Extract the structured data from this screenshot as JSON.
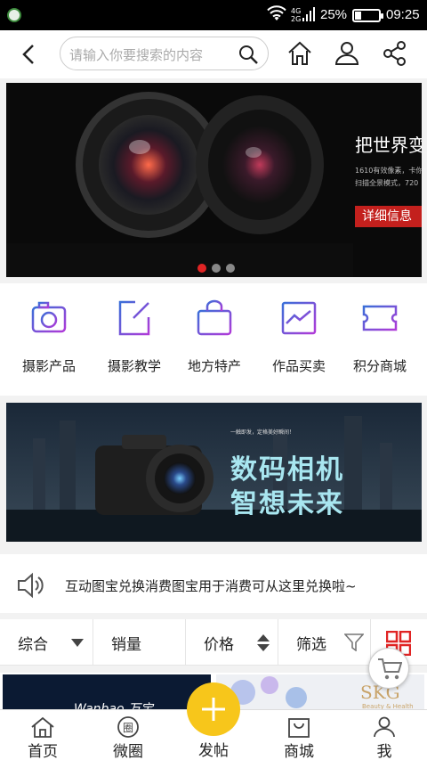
{
  "status_bar": {
    "network": "4G 2G",
    "battery_percent": "25%",
    "battery_level": 0.25,
    "time": "09:25"
  },
  "header": {
    "search_placeholder": "请输入你要搜索的内容"
  },
  "banner": {
    "headline": "把世界变",
    "detail_lines": "1610有效像素，卡你\n扫描全景模式，720",
    "button": "详细信息",
    "slide_count": 3,
    "active_slide": 1
  },
  "categories": [
    {
      "label": "摄影产品",
      "icon": "camera-icon"
    },
    {
      "label": "摄影教学",
      "icon": "edit-icon"
    },
    {
      "label": "地方特产",
      "icon": "shopping-bag-icon"
    },
    {
      "label": "作品买卖",
      "icon": "image-icon"
    },
    {
      "label": "积分商城",
      "icon": "ticket-icon"
    }
  ],
  "banner2": {
    "tagline": "一触即发，定格美好瞬间！",
    "line1": "数码相机",
    "line2": "智想未来"
  },
  "notice": {
    "text": "互动图宝兑换消费图宝用于消费可从这里兑换啦~"
  },
  "filters": {
    "sort_all": "综合",
    "sales": "销量",
    "price": "价格",
    "filter": "筛选"
  },
  "products": {
    "brand1": "Wanbao 万宝",
    "brand2": "SKG",
    "brand2_sub": "Beauty & Health"
  },
  "bottom_nav": {
    "home": "首页",
    "circle": "微圈",
    "post": "发帖",
    "mall": "商城",
    "me": "我"
  },
  "colors": {
    "accent_red": "#e02424",
    "post_yellow": "#f7c61b",
    "icon_gradient_start": "#3a6fd8",
    "icon_gradient_end": "#b03ad8"
  }
}
